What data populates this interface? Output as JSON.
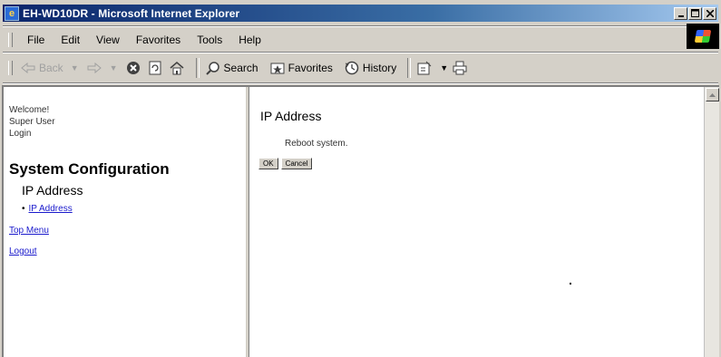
{
  "window": {
    "title": "EH-WD10DR - Microsoft Internet Explorer",
    "controls": [
      "_",
      "□",
      "×"
    ]
  },
  "menu": {
    "items": [
      "File",
      "Edit",
      "View",
      "Favorites",
      "Tools",
      "Help"
    ]
  },
  "toolbar": {
    "back_label": "Back",
    "search_label": "Search",
    "favorites_label": "Favorites",
    "history_label": "History",
    "icons": [
      "back-arrow-icon",
      "forward-arrow-icon",
      "stop-icon",
      "refresh-icon",
      "home-icon",
      "search-icon",
      "favorites-icon",
      "history-icon",
      "mail-icon",
      "print-icon"
    ]
  },
  "sidebar": {
    "welcome": "Welcome!",
    "user": "Super User",
    "login": "Login",
    "section_title": "System Configuration",
    "subsection": "IP Address",
    "links": [
      {
        "label": "IP Address"
      }
    ],
    "top_menu": "Top Menu",
    "logout": "Logout"
  },
  "main": {
    "page_title": "IP Address",
    "message": "Reboot system.",
    "ok_button": "OK",
    "cancel_button": "Cancel"
  },
  "colors": {
    "titlebar_start": "#0a246a",
    "titlebar_end": "#a6caf0",
    "chrome": "#d4d0c8",
    "link": "#1a1acc"
  }
}
